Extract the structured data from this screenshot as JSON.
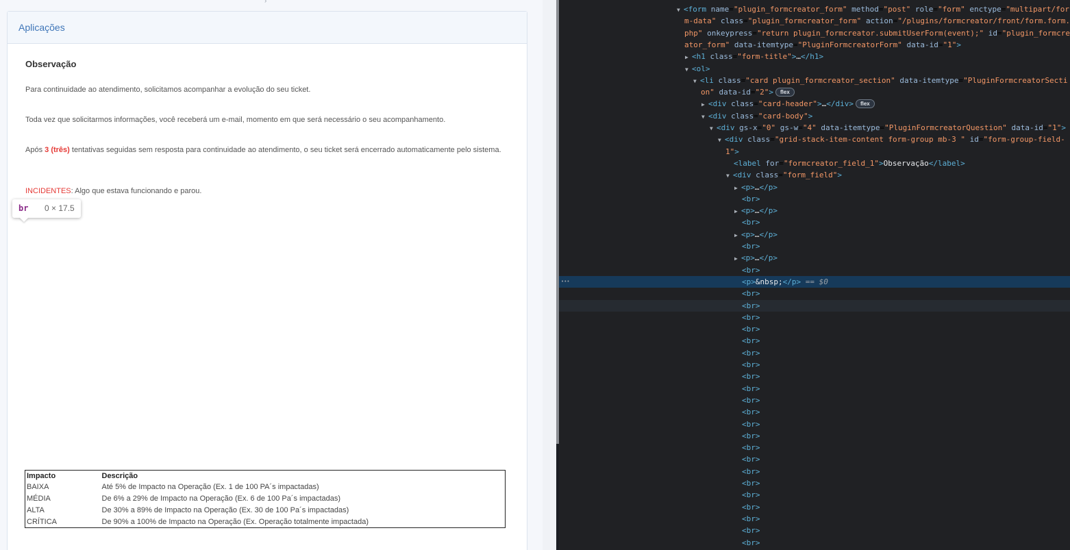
{
  "page": {
    "section_title": "Aplicações",
    "field_label": "Observação",
    "p1": "Para continuidade ao atendimento, solicitamos acompanhar a evolução do seu ticket.",
    "p2": "Toda vez que solicitarmos informações, você receberá um e-mail, momento em que será necessário o seu acompanhamento.",
    "p3_before": "Após ",
    "p3_red": "3 (três)",
    "p3_after": " tentativas seguidas sem resposta para continuidade ao atendimento, o seu ticket será encerrado automaticamente pelo sistema.",
    "p4_red": "INCIDENTES",
    "p4_after": ": Algo que estava funcionando e parou.",
    "tooltip": {
      "tag": "br",
      "dims": "0 × 17.5"
    },
    "table": {
      "headers": [
        "Impacto",
        "Descrição"
      ],
      "rows": [
        [
          "BAIXA",
          "Até 5% de Impacto na Operação (Ex. 1 de 100 PA´s impactadas)"
        ],
        [
          "MÉDIA",
          "De 6% a 29% de Impacto na Operação (Ex. 6 de 100 Pa´s impactadas)"
        ],
        [
          "ALTA",
          "De 30% a 89% de Impacto na Operação (Ex. 30 de 100 Pa´s impactadas)"
        ],
        [
          "CRÍTICA",
          "De 90% a 100% de Impacto na Operação (Ex. Operação totalmente impactada)"
        ]
      ]
    }
  },
  "devtools": {
    "lines": [
      {
        "indent": 0,
        "tri": "down",
        "html": "<span class='tag'>&lt;form</span> <span class='an'>name</span>=<span class='av'>\"plugin_formcreator_form\"</span> <span class='an'>method</span>=<span class='av'>\"post\"</span> <span class='an'>role</span>=<span class='av'>\"form\"</span> <span class='an'>enctype</span>=<span class='av'>\"multipart/for</span>"
      },
      {
        "indent": 0,
        "tri": "",
        "html": "<span class='av'>m-data\"</span> <span class='an'>class</span>=<span class='av'>\"plugin_formcreator_form\"</span> <span class='an'>action</span>=<span class='av'>\"/plugins/formcreator/front/form.form.</span>"
      },
      {
        "indent": 0,
        "tri": "",
        "html": "<span class='av'>php\"</span> <span class='an'>onkeypress</span>=<span class='av'>\"return plugin_formcreator.submitUserForm(event);\"</span> <span class='an'>id</span>=<span class='av'>\"plugin_formcre</span>"
      },
      {
        "indent": 0,
        "tri": "",
        "html": "<span class='av'>ator_form\"</span> <span class='an'>data-itemtype</span>=<span class='av'>\"PluginFormcreatorForm\"</span> <span class='an'>data-id</span>=<span class='av'>\"1\"</span><span class='tag'>&gt;</span>"
      },
      {
        "indent": 1,
        "tri": "right",
        "html": "<span class='tag'>&lt;h1</span> <span class='an'>class</span>=<span class='av'>\"form-title\"</span><span class='tag'>&gt;</span><span class='txt'>…</span><span class='tag'>&lt;/h1&gt;</span>"
      },
      {
        "indent": 1,
        "tri": "down",
        "html": "<span class='tag'>&lt;ol&gt;</span>"
      },
      {
        "indent": 2,
        "tri": "down",
        "html": "<span class='tag'>&lt;li</span> <span class='an'>class</span>=<span class='av'>\"card plugin_formcreator_section\"</span> <span class='an'>data-itemtype</span>=<span class='av'>\"PluginFormcreatorSecti</span>"
      },
      {
        "indent": 2,
        "tri": "",
        "html": "<span class='av'>on\"</span> <span class='an'>data-id</span>=<span class='av'>\"2\"</span><span class='tag'>&gt;</span><span class='pill'>flex</span>"
      },
      {
        "indent": 3,
        "tri": "right",
        "html": "<span class='tag'>&lt;div</span> <span class='an'>class</span>=<span class='av'>\"card-header\"</span><span class='tag'>&gt;</span><span class='txt'>…</span><span class='tag'>&lt;/div&gt;</span><span class='pill'>flex</span>"
      },
      {
        "indent": 3,
        "tri": "down",
        "html": "<span class='tag'>&lt;div</span> <span class='an'>class</span>=<span class='av'>\"card-body\"</span><span class='tag'>&gt;</span>"
      },
      {
        "indent": 4,
        "tri": "down",
        "html": "<span class='tag'>&lt;div</span> <span class='an'>gs-x</span>=<span class='av'>\"0\"</span> <span class='an'>gs-w</span>=<span class='av'>\"4\"</span> <span class='an'>data-itemtype</span>=<span class='av'>\"PluginFormcreatorQuestion\"</span> <span class='an'>data-id</span>=<span class='av'>\"1\"</span><span class='tag'>&gt;</span>"
      },
      {
        "indent": 5,
        "tri": "down",
        "html": "<span class='tag'>&lt;div</span> <span class='an'>class</span>=<span class='av'>\"grid-stack-item-content form-group mb-3 \"</span> <span class='an'>id</span>=<span class='av'>\"form-group-field-</span>"
      },
      {
        "indent": 5,
        "tri": "",
        "html": "<span class='av'>1\"</span><span class='tag'>&gt;</span>"
      },
      {
        "indent": 6,
        "tri": "",
        "html": "<span class='tag'>&lt;label</span> <span class='an'>for</span>=<span class='av'>\"formcreator_field_1\"</span><span class='tag'>&gt;</span><span class='txt'>Observação</span><span class='tag'>&lt;/label&gt;</span>"
      },
      {
        "indent": 6,
        "tri": "down",
        "html": "<span class='tag'>&lt;div</span> <span class='an'>class</span>=<span class='av'>\"form_field\"</span><span class='tag'>&gt;</span>"
      },
      {
        "indent": 7,
        "tri": "right",
        "html": "<span class='tag'>&lt;p&gt;</span><span class='txt'>…</span><span class='tag'>&lt;/p&gt;</span>"
      },
      {
        "indent": 7,
        "tri": "",
        "html": "<span class='tag'>&lt;br&gt;</span>"
      },
      {
        "indent": 7,
        "tri": "right",
        "html": "<span class='tag'>&lt;p&gt;</span><span class='txt'>…</span><span class='tag'>&lt;/p&gt;</span>"
      },
      {
        "indent": 7,
        "tri": "",
        "html": "<span class='tag'>&lt;br&gt;</span>"
      },
      {
        "indent": 7,
        "tri": "right",
        "html": "<span class='tag'>&lt;p&gt;</span><span class='txt'>…</span><span class='tag'>&lt;/p&gt;</span>"
      },
      {
        "indent": 7,
        "tri": "",
        "html": "<span class='tag'>&lt;br&gt;</span>"
      },
      {
        "indent": 7,
        "tri": "right",
        "html": "<span class='tag'>&lt;p&gt;</span><span class='txt'>…</span><span class='tag'>&lt;/p&gt;</span>"
      },
      {
        "indent": 7,
        "tri": "",
        "html": "<span class='tag'>&lt;br&gt;</span>"
      },
      {
        "indent": 7,
        "tri": "",
        "sel": true,
        "html": "<span class='tag'>&lt;p&gt;</span><span class='txt'>&amp;nbsp;</span><span class='tag'>&lt;/p&gt;</span> <span class='eq'>== $0</span>"
      },
      {
        "indent": 7,
        "tri": "",
        "html": "<span class='tag'>&lt;br&gt;</span>"
      },
      {
        "indent": 7,
        "tri": "",
        "hov": true,
        "html": "<span class='tag'>&lt;br&gt;</span>"
      },
      {
        "indent": 7,
        "tri": "",
        "html": "<span class='tag'>&lt;br&gt;</span>"
      },
      {
        "indent": 7,
        "tri": "",
        "html": "<span class='tag'>&lt;br&gt;</span>"
      },
      {
        "indent": 7,
        "tri": "",
        "html": "<span class='tag'>&lt;br&gt;</span>"
      },
      {
        "indent": 7,
        "tri": "",
        "html": "<span class='tag'>&lt;br&gt;</span>"
      },
      {
        "indent": 7,
        "tri": "",
        "html": "<span class='tag'>&lt;br&gt;</span>"
      },
      {
        "indent": 7,
        "tri": "",
        "html": "<span class='tag'>&lt;br&gt;</span>"
      },
      {
        "indent": 7,
        "tri": "",
        "html": "<span class='tag'>&lt;br&gt;</span>"
      },
      {
        "indent": 7,
        "tri": "",
        "html": "<span class='tag'>&lt;br&gt;</span>"
      },
      {
        "indent": 7,
        "tri": "",
        "html": "<span class='tag'>&lt;br&gt;</span>"
      },
      {
        "indent": 7,
        "tri": "",
        "html": "<span class='tag'>&lt;br&gt;</span>"
      },
      {
        "indent": 7,
        "tri": "",
        "html": "<span class='tag'>&lt;br&gt;</span>"
      },
      {
        "indent": 7,
        "tri": "",
        "html": "<span class='tag'>&lt;br&gt;</span>"
      },
      {
        "indent": 7,
        "tri": "",
        "html": "<span class='tag'>&lt;br&gt;</span>"
      },
      {
        "indent": 7,
        "tri": "",
        "html": "<span class='tag'>&lt;br&gt;</span>"
      },
      {
        "indent": 7,
        "tri": "",
        "html": "<span class='tag'>&lt;br&gt;</span>"
      },
      {
        "indent": 7,
        "tri": "",
        "html": "<span class='tag'>&lt;br&gt;</span>"
      },
      {
        "indent": 7,
        "tri": "",
        "html": "<span class='tag'>&lt;br&gt;</span>"
      },
      {
        "indent": 7,
        "tri": "",
        "html": "<span class='tag'>&lt;br&gt;</span>"
      },
      {
        "indent": 7,
        "tri": "",
        "html": "<span class='tag'>&lt;br&gt;</span>"
      },
      {
        "indent": 7,
        "tri": "",
        "html": "<span class='tag'>&lt;br&gt;</span>"
      },
      {
        "indent": 7,
        "tri": "",
        "html": "<span class='tag'>&lt;br&gt;</span>"
      }
    ]
  }
}
